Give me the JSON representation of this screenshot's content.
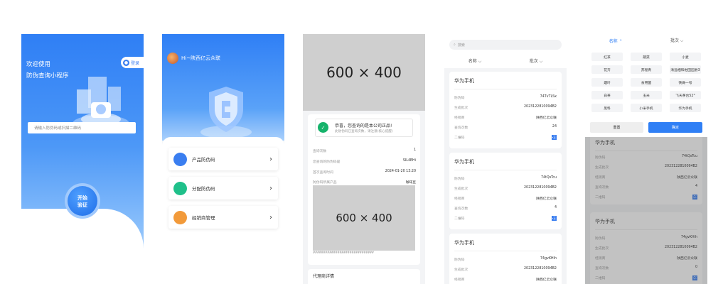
{
  "screen1": {
    "welcome": "欢迎使用",
    "app_title": "防伪查询小程序",
    "login": "登录",
    "input_placeholder": "请输入防伪码或扫描二维码",
    "start_line1": "开始",
    "start_line2": "验证"
  },
  "screen2": {
    "title": "Hi~陕西亿云众联",
    "menu": [
      {
        "label": "产品防伪码",
        "color": "#3a7ef0"
      },
      {
        "label": "分配防伪码",
        "color": "#1fc08a"
      },
      {
        "label": "经销商管理",
        "color": "#f29a3a"
      }
    ]
  },
  "screen3": {
    "placeholder1": "600 × 400",
    "placeholder2": "600 × 400",
    "ok_title": "恭喜，您查询的是本公司正品!",
    "ok_sub": "此防伪码已查询次数，请注意(核心提醒)",
    "rows": [
      {
        "k": "查询次数",
        "v": "1"
      },
      {
        "k": "您查询的防伪码是",
        "v": "SIL4EHi"
      },
      {
        "k": "首次查询时间",
        "v": "2024-01-20 13:20"
      },
      {
        "k": "防伪码所属产品",
        "v": "咖啡豆"
      }
    ],
    "hash": "##############################",
    "bottom_title": "代理商详情"
  },
  "screen4": {
    "search_placeholder": "搜索",
    "filters": [
      "名称",
      "批次"
    ],
    "cards": [
      {
        "title": "华为手机",
        "rows": [
          {
            "k": "防伪码",
            "v": "74TvTLSx"
          },
          {
            "k": "生成批次",
            "v": "2023122810094B2"
          },
          {
            "k": "经销商",
            "v": "陕西亿云众联"
          },
          {
            "k": "查询次数",
            "v": "24"
          },
          {
            "k": "二维码",
            "v": ""
          }
        ]
      },
      {
        "title": "华为手机",
        "rows": [
          {
            "k": "防伪码",
            "v": "74tQsTcu"
          },
          {
            "k": "生成批次",
            "v": "2023122810094B2"
          },
          {
            "k": "经销商",
            "v": "陕西亿云众联"
          },
          {
            "k": "查询次数",
            "v": "4"
          },
          {
            "k": "二维码",
            "v": ""
          }
        ]
      },
      {
        "title": "华为手机",
        "rows": [
          {
            "k": "防伪码",
            "v": "74gvKHih"
          },
          {
            "k": "生成批次",
            "v": "2023122810094B2"
          },
          {
            "k": "经销商",
            "v": "陕西亿云众联"
          }
        ]
      }
    ]
  },
  "screen5": {
    "filters": [
      "名称",
      "批次"
    ],
    "tags": [
      "红茶",
      "蔬菜",
      "小麦",
      "花卉",
      "苏程青",
      "清远相和柑田园县3",
      "烟叶",
      "食用菌",
      "快做一号",
      "白茶",
      "玉米",
      "飞天茅台52°",
      "黑料",
      "小米手机",
      "华为手机"
    ],
    "reset": "重置",
    "confirm": "确定",
    "cards": [
      {
        "title": "华为手机",
        "rows": [
          {
            "k": "防伪码",
            "v": "74tQsTcu"
          },
          {
            "k": "生成批次",
            "v": "2023122810094B2"
          },
          {
            "k": "经销商",
            "v": "陕西亿云众联"
          },
          {
            "k": "查询次数",
            "v": "4"
          },
          {
            "k": "二维码",
            "v": ""
          }
        ]
      },
      {
        "title": "华为手机",
        "rows": [
          {
            "k": "防伪码",
            "v": "74gvKHih"
          },
          {
            "k": "生成批次",
            "v": "2023122810094B2"
          },
          {
            "k": "经销商",
            "v": "陕西亿云众联"
          },
          {
            "k": "查询次数",
            "v": "0"
          },
          {
            "k": "二维码",
            "v": ""
          }
        ]
      }
    ]
  }
}
